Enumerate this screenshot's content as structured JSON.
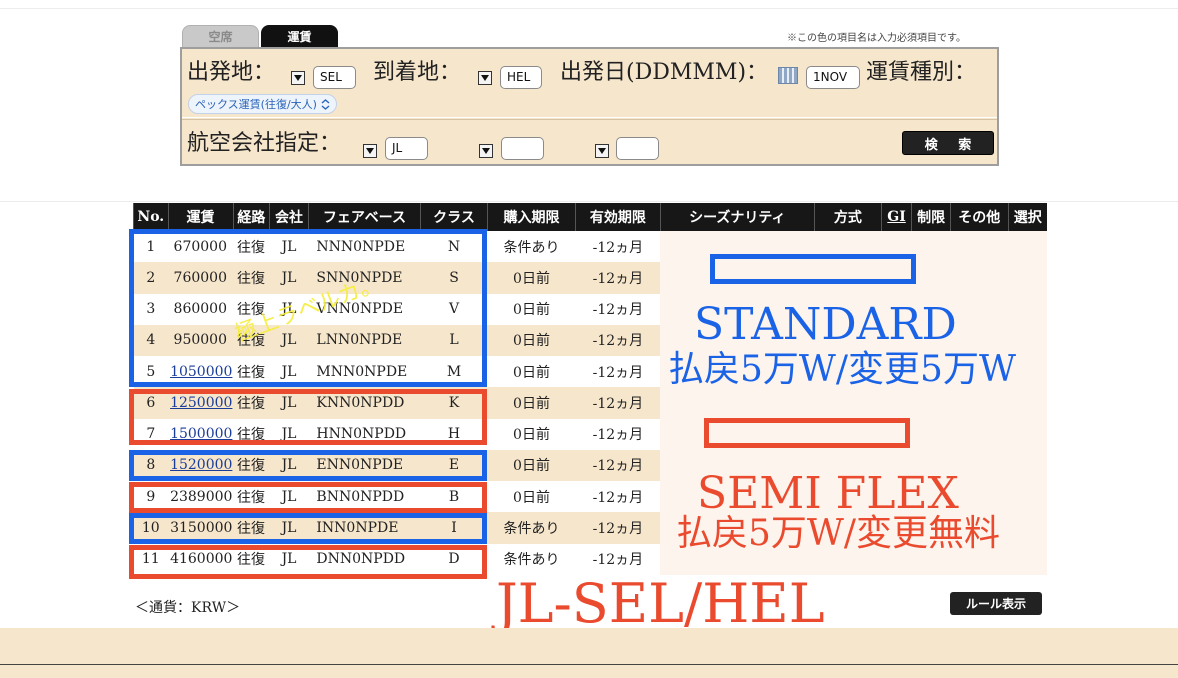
{
  "tabs": [
    {
      "label": "空席",
      "active": false
    },
    {
      "label": "運賃",
      "active": true
    }
  ],
  "required_note": "※この色の項目名は入力必須項目です。",
  "search": {
    "origin_label": "出発地：",
    "origin_value": "SEL",
    "destination_label": "到着地：",
    "destination_value": "HEL",
    "date_label": "出発日(DDMMM)：",
    "date_value": "1NOV",
    "fare_type_label": "運賃種別：",
    "fare_type_value": "ペックス運賃(往復/大人)",
    "airline_label": "航空会社指定：",
    "airline_values": [
      "JL",
      "",
      ""
    ],
    "search_button": "検 索"
  },
  "table": {
    "headers": [
      "No.",
      "運賃",
      "経路",
      "会社",
      "フェアベース",
      "クラス",
      "購入期限",
      "有効期限",
      "シーズナリティ",
      "方式",
      "GI",
      "制限",
      "その他",
      "選択"
    ],
    "rows": [
      {
        "no": "1",
        "fare": "670000",
        "fare_link": false,
        "route": "往復",
        "carrier": "JL",
        "basis": "NNN0NPDE",
        "cls": "N",
        "purchase": "条件あり",
        "valid": "-12ヵ月"
      },
      {
        "no": "2",
        "fare": "760000",
        "fare_link": false,
        "route": "往復",
        "carrier": "JL",
        "basis": "SNN0NPDE",
        "cls": "S",
        "purchase": "0日前",
        "valid": "-12ヵ月"
      },
      {
        "no": "3",
        "fare": "860000",
        "fare_link": false,
        "route": "往復",
        "carrier": "JL",
        "basis": "VNN0NPDE",
        "cls": "V",
        "purchase": "0日前",
        "valid": "-12ヵ月"
      },
      {
        "no": "4",
        "fare": "950000",
        "fare_link": false,
        "route": "往復",
        "carrier": "JL",
        "basis": "LNN0NPDE",
        "cls": "L",
        "purchase": "0日前",
        "valid": "-12ヵ月"
      },
      {
        "no": "5",
        "fare": "1050000",
        "fare_link": true,
        "route": "往復",
        "carrier": "JL",
        "basis": "MNN0NPDE",
        "cls": "M",
        "purchase": "0日前",
        "valid": "-12ヵ月"
      },
      {
        "no": "6",
        "fare": "1250000",
        "fare_link": true,
        "route": "往復",
        "carrier": "JL",
        "basis": "KNN0NPDD",
        "cls": "K",
        "purchase": "0日前",
        "valid": "-12ヵ月"
      },
      {
        "no": "7",
        "fare": "1500000",
        "fare_link": true,
        "route": "往復",
        "carrier": "JL",
        "basis": "HNN0NPDD",
        "cls": "H",
        "purchase": "0日前",
        "valid": "-12ヵ月"
      },
      {
        "no": "8",
        "fare": "1520000",
        "fare_link": true,
        "route": "往復",
        "carrier": "JL",
        "basis": "ENN0NPDE",
        "cls": "E",
        "purchase": "0日前",
        "valid": "-12ヵ月"
      },
      {
        "no": "9",
        "fare": "2389000",
        "fare_link": false,
        "route": "往復",
        "carrier": "JL",
        "basis": "BNN0NPDD",
        "cls": "B",
        "purchase": "0日前",
        "valid": "-12ヵ月"
      },
      {
        "no": "10",
        "fare": "3150000",
        "fare_link": false,
        "route": "往復",
        "carrier": "JL",
        "basis": "INN0NPDE",
        "cls": "I",
        "purchase": "条件あり",
        "valid": "-12ヵ月"
      },
      {
        "no": "11",
        "fare": "4160000",
        "fare_link": false,
        "route": "往復",
        "carrier": "JL",
        "basis": "DNN0NPDD",
        "cls": "D",
        "purchase": "条件あり",
        "valid": "-12ヵ月"
      }
    ]
  },
  "annotations": {
    "handwritten": "極上ラベルカ。",
    "standard_title": "STANDARD",
    "standard_detail": "払戻5万W/変更5万W",
    "semiflex_title": "SEMI FLEX",
    "semiflex_detail": "払戻5万W/変更無料",
    "route_title": "JL-SEL/HEL"
  },
  "currency_note": "＜通貨：KRW＞",
  "rule_button": "ルール表示",
  "colors": {
    "beige": "#f6e6cc",
    "header_black": "#171717",
    "annotation_blue": "#1a63e6",
    "annotation_red": "#ea4b2e",
    "link_blue": "#1b3d9a"
  }
}
